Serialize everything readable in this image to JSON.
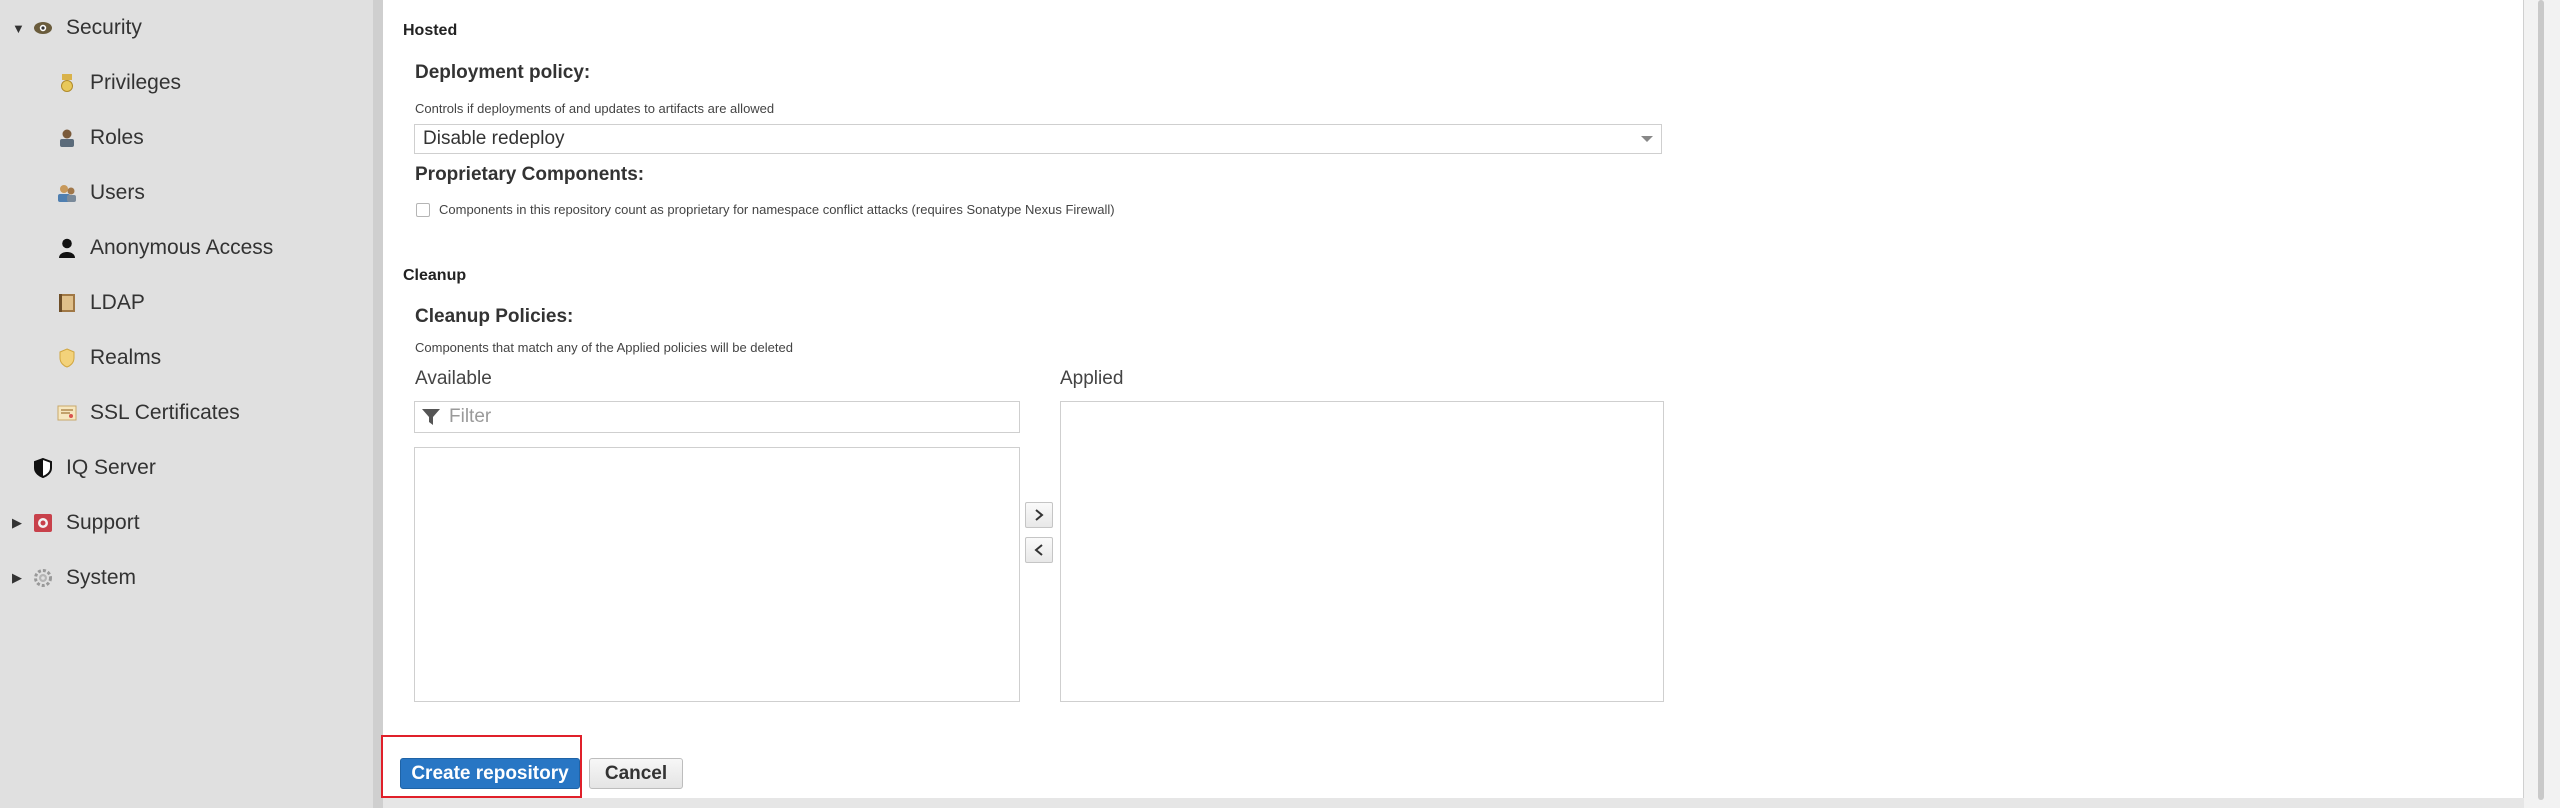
{
  "sidebar": {
    "items": [
      {
        "label": "Security",
        "icon": "eye-icon",
        "expanded": true
      },
      {
        "label": "Privileges",
        "icon": "medal-icon"
      },
      {
        "label": "Roles",
        "icon": "user-badge-icon"
      },
      {
        "label": "Users",
        "icon": "users-icon"
      },
      {
        "label": "Anonymous Access",
        "icon": "user-icon"
      },
      {
        "label": "LDAP",
        "icon": "book-icon"
      },
      {
        "label": "Realms",
        "icon": "shield-icon"
      },
      {
        "label": "SSL Certificates",
        "icon": "certificate-icon"
      },
      {
        "label": "IQ Server",
        "icon": "half-shield-icon"
      },
      {
        "label": "Support",
        "icon": "lifebuoy-icon",
        "expanded": false
      },
      {
        "label": "System",
        "icon": "gear-icon",
        "expanded": false
      }
    ]
  },
  "hosted": {
    "section_title": "Hosted",
    "deployment_policy": {
      "label": "Deployment policy:",
      "help": "Controls if deployments of and updates to artifacts are allowed",
      "value": "Disable redeploy"
    },
    "proprietary": {
      "label": "Proprietary Components:",
      "checkbox_label": "Components in this repository count as proprietary for namespace conflict attacks (requires Sonatype Nexus Firewall)",
      "checked": false
    }
  },
  "cleanup": {
    "section_title": "Cleanup",
    "policies_label": "Cleanup Policies:",
    "help": "Components that match any of the Applied policies will be deleted",
    "available_label": "Available",
    "applied_label": "Applied",
    "filter_placeholder": "Filter"
  },
  "actions": {
    "create_label": "Create repository",
    "cancel_label": "Cancel"
  },
  "colors": {
    "primary": "#2876c4",
    "highlight": "#e0202a"
  }
}
